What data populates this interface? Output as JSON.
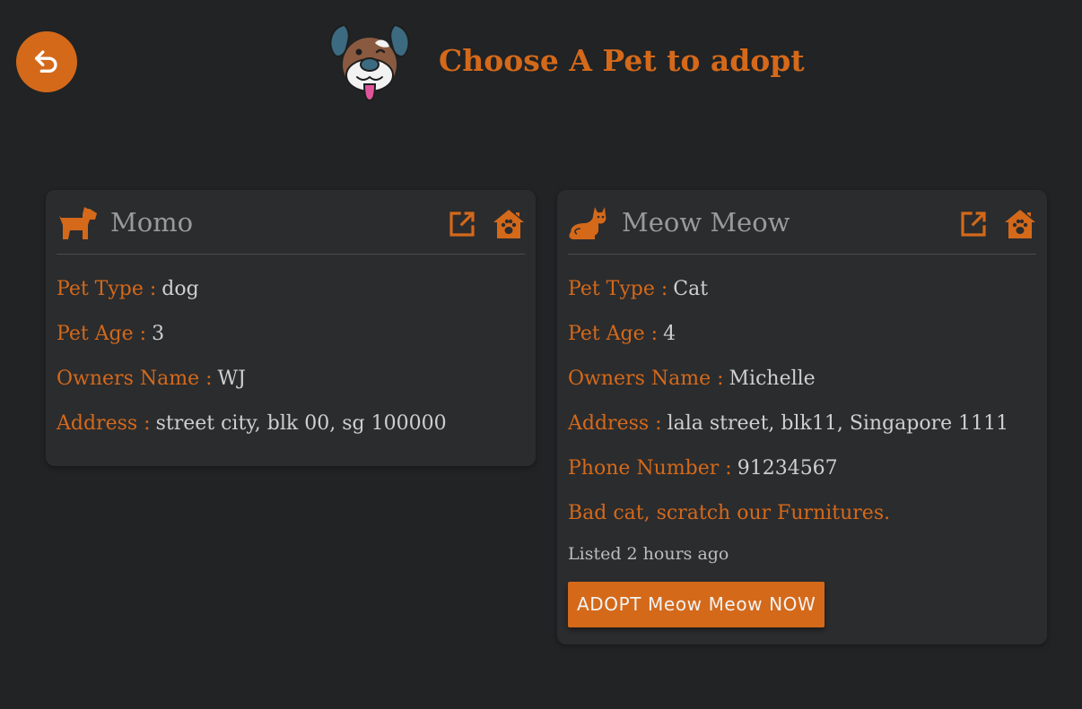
{
  "header": {
    "title": "Choose A Pet to adopt",
    "back_icon": "undo-arrow-icon",
    "logo_icon": "dog-face-logo"
  },
  "colors": {
    "accent": "#d4691a",
    "background": "#212325",
    "card": "#2b2c2e",
    "muted_text": "#9a9a9a",
    "value_text": "#cfcfcf"
  },
  "pets": [
    {
      "name": "Momo",
      "icon": "dog-icon",
      "type_label": "Pet Type :",
      "type_value": "dog",
      "age_label": "Pet Age :",
      "age_value": "3",
      "owner_label": "Owners Name :",
      "owner_value": "WJ",
      "address_label": "Address :",
      "address_value": "street city, blk 00, sg 100000"
    },
    {
      "name": "Meow Meow",
      "icon": "cat-icon",
      "type_label": "Pet Type :",
      "type_value": "Cat",
      "age_label": "Pet Age :",
      "age_value": "4",
      "owner_label": "Owners Name :",
      "owner_value": "Michelle",
      "address_label": "Address :",
      "address_value": "lala street, blk11, Singapore 1111",
      "phone_label": "Phone Number :",
      "phone_value": "91234567",
      "description": "Bad cat, scratch our Furnitures.",
      "listed": "Listed 2 hours ago",
      "adopt_button": "ADOPT Meow Meow NOW"
    }
  ]
}
